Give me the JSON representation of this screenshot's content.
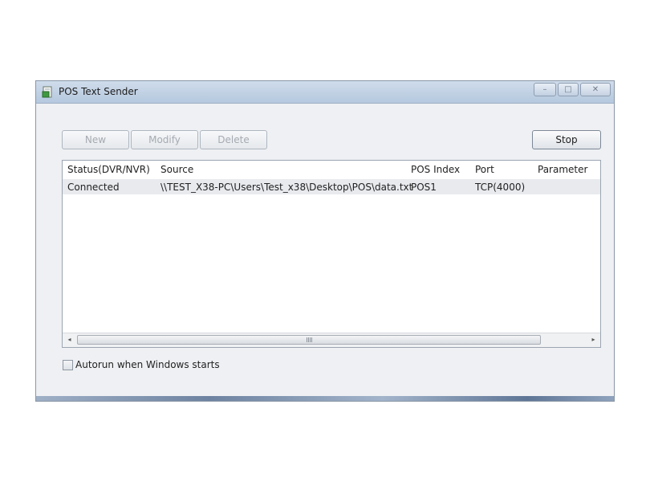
{
  "window": {
    "title": "POS Text Sender",
    "controls": {
      "minimize": "–",
      "maximize": "□",
      "close": "✕"
    }
  },
  "toolbar": {
    "new_label": "New",
    "modify_label": "Modify",
    "delete_label": "Delete",
    "stop_label": "Stop"
  },
  "list": {
    "columns": [
      "Status(DVR/NVR)",
      "Source",
      "POS Index",
      "Port",
      "Parameter"
    ],
    "rows": [
      [
        "Connected",
        "\\\\TEST_X38-PC\\Users\\Test_x38\\Desktop\\POS\\data.txt",
        "POS1",
        "TCP(4000)",
        ""
      ]
    ]
  },
  "scrollbar": {
    "left_arrow": "◂",
    "right_arrow": "▸"
  },
  "options": {
    "autorun_label": "Autorun when Windows starts",
    "autorun_checked": false
  },
  "colors": {
    "titlebar": "#c3d3e6",
    "window_bg": "#eef0f3",
    "selected_row": "#e8eaee"
  },
  "icons": {
    "app": "document-green-icon"
  }
}
